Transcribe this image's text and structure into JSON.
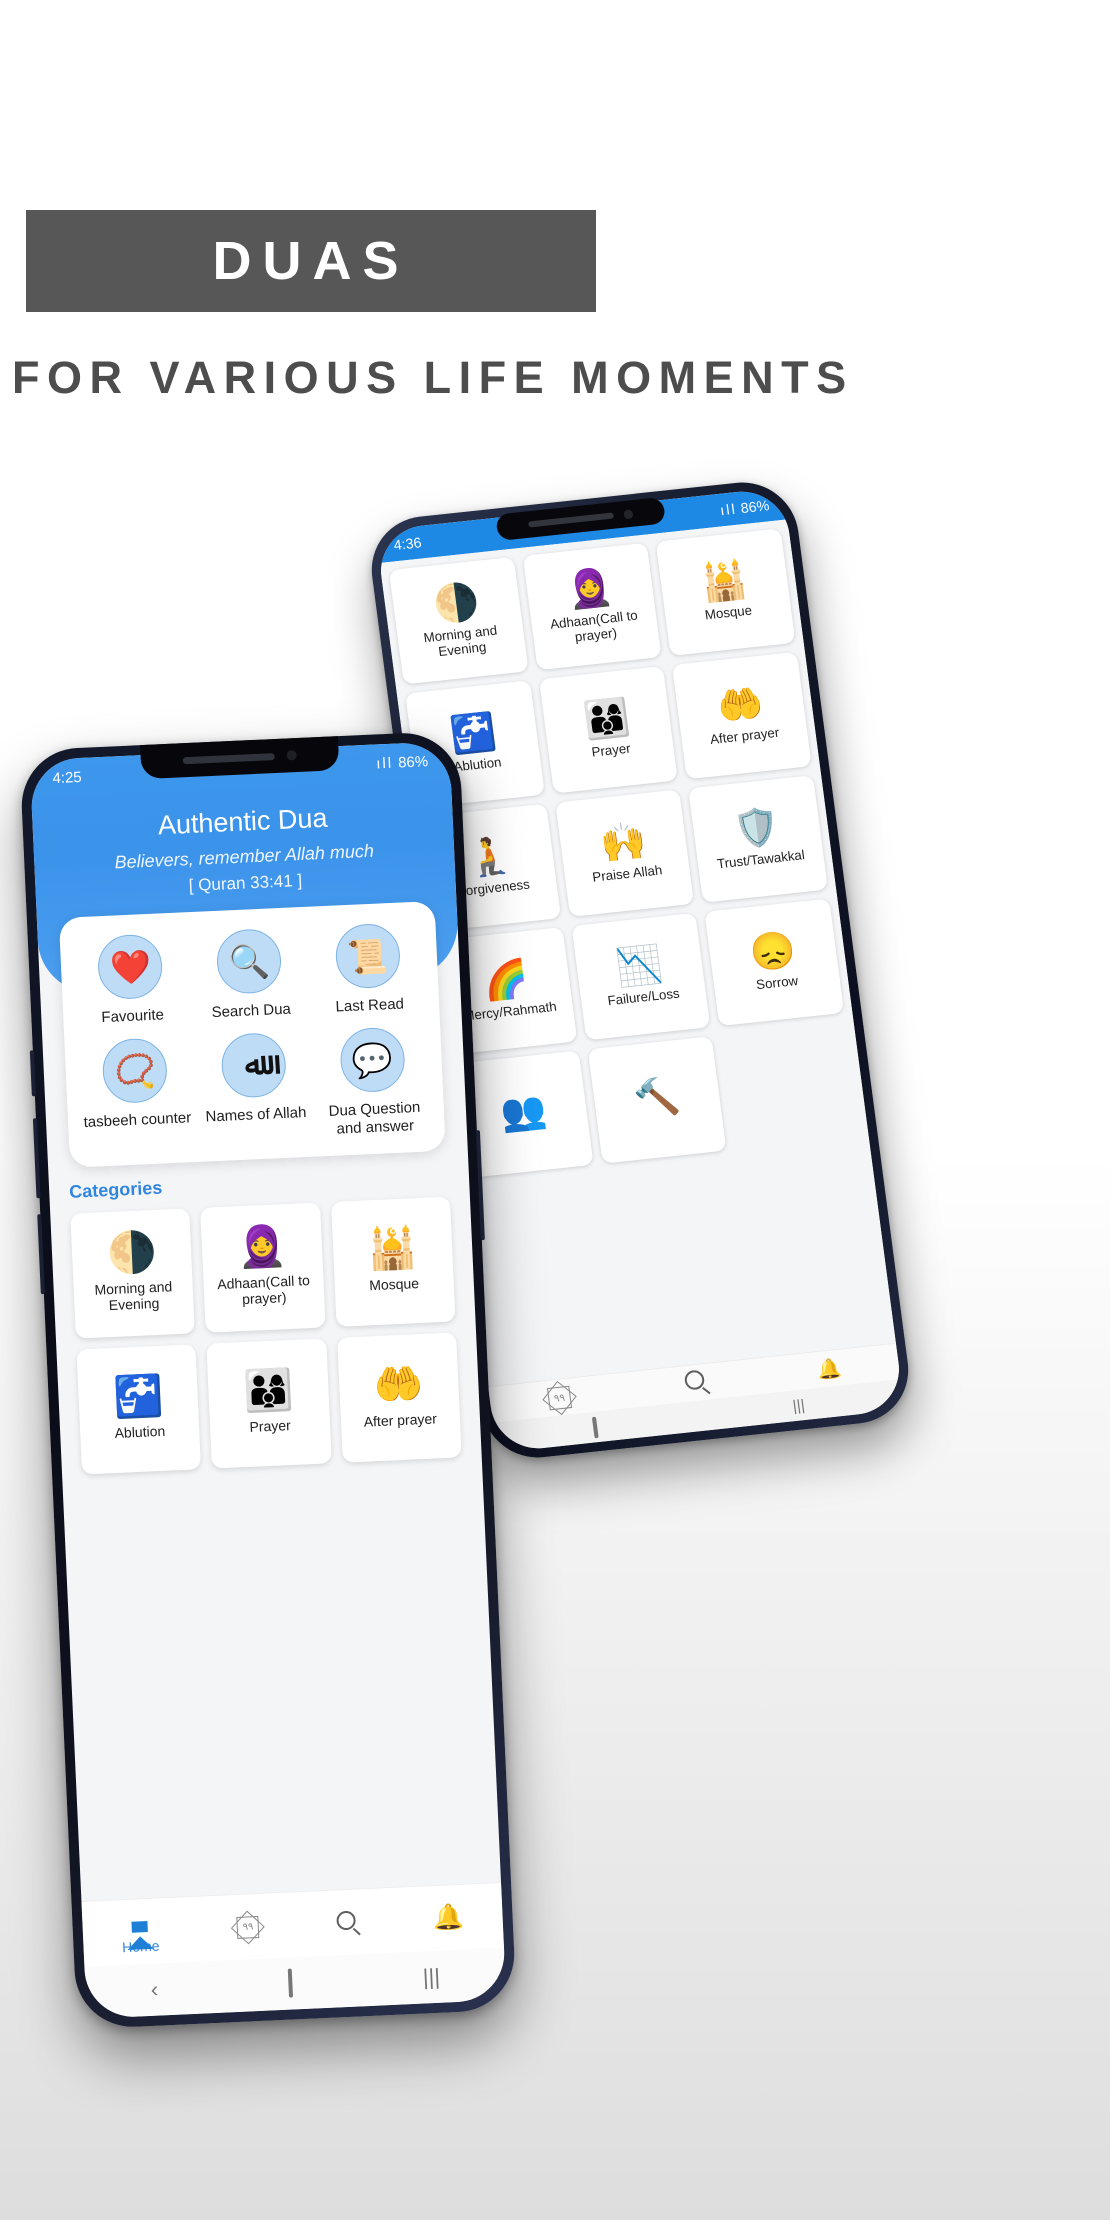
{
  "promo": {
    "title": "DUAS",
    "subtitle": "FOR VARIOUS LIFE MOMENTS",
    "band_color": "#575757",
    "subtitle_color": "#4d4d4d"
  },
  "front_phone": {
    "status": {
      "time": "4:25",
      "signal": "ıll",
      "battery": "86%"
    },
    "app_title": "Authentic Dua",
    "verse": "Believers, remember Allah much",
    "verse_ref": "[ Quran 33:41 ]",
    "accent_color": "#3d97ec",
    "quick_actions": [
      {
        "label": "Favourite",
        "icon": "heart-icon",
        "glyph": "❤️"
      },
      {
        "label": "Search Dua",
        "icon": "magnifier-chat-icon",
        "glyph": "🔍"
      },
      {
        "label": "Last Read",
        "icon": "scroll-clock-icon",
        "glyph": "📜"
      },
      {
        "label": "tasbeeh counter",
        "icon": "prayer-beads-icon",
        "glyph": "📿"
      },
      {
        "label": "Names of Allah",
        "icon": "allah-calligraphy-icon",
        "glyph": "ﷲ"
      },
      {
        "label": "Dua Question and answer",
        "icon": "qa-bubbles-icon",
        "glyph": "💬"
      }
    ],
    "categories_heading": "Categories",
    "categories": [
      {
        "label": "Morning and Evening",
        "icon": "day-night-icon",
        "glyph": "🌗"
      },
      {
        "label": "Adhaan(Call to prayer)",
        "icon": "muezzin-icon",
        "glyph": "🧕"
      },
      {
        "label": "Mosque",
        "icon": "mosque-icon",
        "glyph": "🕌"
      },
      {
        "label": "Ablution",
        "icon": "wudu-tap-icon",
        "glyph": "🚰"
      },
      {
        "label": "Prayer",
        "icon": "congregation-icon",
        "glyph": "👨‍👩‍👦"
      },
      {
        "label": "After prayer",
        "icon": "sun-prostration-icon",
        "glyph": "🤲"
      }
    ],
    "bottom_nav": [
      {
        "label": "Home",
        "icon": "home-icon",
        "active": true
      },
      {
        "label": "",
        "icon": "names-99-icon",
        "active": false
      },
      {
        "label": "",
        "icon": "search-icon",
        "active": false
      },
      {
        "label": "",
        "icon": "bell-icon",
        "active": false
      }
    ],
    "system_nav": [
      {
        "icon": "back-icon",
        "glyph": "‹"
      },
      {
        "icon": "home-square-icon",
        "glyph": "▢"
      },
      {
        "icon": "recents-icon",
        "glyph": "|||"
      }
    ]
  },
  "back_phone": {
    "status": {
      "time": "4:36",
      "signal": "ıll",
      "battery": "86%"
    },
    "categories": [
      {
        "label": "Morning and Evening",
        "icon": "day-night-icon",
        "glyph": "🌗"
      },
      {
        "label": "Adhaan(Call to prayer)",
        "icon": "muezzin-icon",
        "glyph": "🧕"
      },
      {
        "label": "Mosque",
        "icon": "mosque-icon",
        "glyph": "🕌"
      },
      {
        "label": "Ablution",
        "icon": "wudu-tap-icon",
        "glyph": "🚰"
      },
      {
        "label": "Prayer",
        "icon": "congregation-icon",
        "glyph": "👨‍👩‍👦"
      },
      {
        "label": "After prayer",
        "icon": "sun-prostration-icon",
        "glyph": "🤲"
      },
      {
        "label": "Forgiveness",
        "icon": "kneeling-man-icon",
        "glyph": "🧎"
      },
      {
        "label": "Praise Allah",
        "icon": "raised-hands-icon",
        "glyph": "🙌"
      },
      {
        "label": "Trust/Tawakkal",
        "icon": "shield-hands-icon",
        "glyph": "🛡️"
      },
      {
        "label": "Mercy/Rahmath",
        "icon": "rainbow-cloud-icon",
        "glyph": "🌈"
      },
      {
        "label": "Failure/Loss",
        "icon": "falling-arrow-icon",
        "glyph": "📉"
      },
      {
        "label": "Sorrow",
        "icon": "sad-person-icon",
        "glyph": "😞"
      },
      {
        "label": "",
        "icon": "people-icon",
        "glyph": "👥"
      },
      {
        "label": "",
        "icon": "gavel-icon",
        "glyph": "🔨"
      }
    ],
    "bottom_nav": [
      {
        "icon": "names-99-icon"
      },
      {
        "icon": "search-icon"
      },
      {
        "icon": "bell-icon"
      }
    ],
    "system_nav": [
      {
        "icon": "home-square-icon",
        "glyph": "▢"
      },
      {
        "icon": "recents-icon",
        "glyph": "|||"
      }
    ]
  }
}
